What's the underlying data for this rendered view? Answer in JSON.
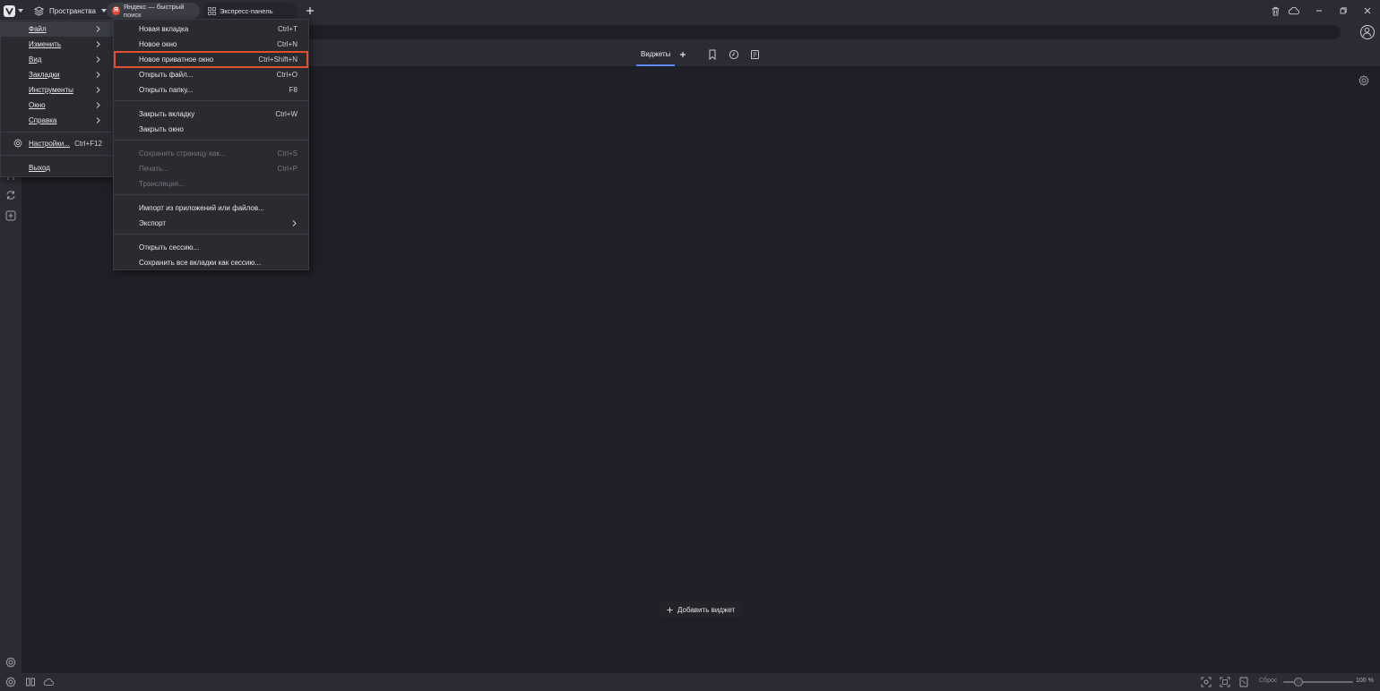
{
  "tabbar": {
    "spaces_label": "Пространства",
    "tabs": [
      {
        "title": "Яндекс — быстрый поиск",
        "favicon": "Я"
      },
      {
        "title": "Экспресс-панель"
      }
    ]
  },
  "speed_dial": {
    "active_tab": "Виджеты",
    "add_widget_label": "Добавить виджет"
  },
  "main_menu": {
    "items": [
      {
        "label": "Файл",
        "has_submenu": true
      },
      {
        "label": "Изменить",
        "has_submenu": true
      },
      {
        "label": "Вид",
        "has_submenu": true
      },
      {
        "label": "Закладки",
        "has_submenu": true
      },
      {
        "label": "Инструменты",
        "has_submenu": true
      },
      {
        "label": "Окно",
        "has_submenu": true
      },
      {
        "label": "Справка",
        "has_submenu": true
      },
      {
        "label": "Настройки...",
        "shortcut": "Ctrl+F12"
      },
      {
        "label": "Выход"
      }
    ]
  },
  "file_menu": {
    "items": [
      {
        "label": "Новая вкладка",
        "shortcut": "Ctrl+T"
      },
      {
        "label": "Новое окно",
        "shortcut": "Ctrl+N"
      },
      {
        "label": "Новое приватное окно",
        "shortcut": "Ctrl+Shift+N",
        "highlighted": true
      },
      {
        "label": "Открыть файл...",
        "shortcut": "Ctrl+O"
      },
      {
        "label": "Открыть папку...",
        "shortcut": "F8"
      },
      {
        "label": "Закрыть вкладку",
        "shortcut": "Ctrl+W"
      },
      {
        "label": "Закрыть окно",
        "shortcut": ""
      },
      {
        "label": "Сохранить страницу как...",
        "shortcut": "Ctrl+S",
        "disabled": true
      },
      {
        "label": "Печать...",
        "shortcut": "Ctrl+P",
        "disabled": true
      },
      {
        "label": "Трансляция...",
        "shortcut": "",
        "disabled": true
      },
      {
        "label": "Импорт из приложений или файлов...",
        "shortcut": ""
      },
      {
        "label": "Экспорт",
        "has_submenu": true
      },
      {
        "label": "Открыть сессию...",
        "shortcut": ""
      },
      {
        "label": "Сохранить все вкладки как сессию...",
        "shortcut": ""
      }
    ]
  },
  "statusbar": {
    "reset_label": "Сброс",
    "zoom_percent": 100,
    "zoom_label": "100 %"
  },
  "colors": {
    "background": "#1f2027",
    "chrome": "#2b2c33",
    "menu": "#2a2b31",
    "highlight_outline": "#e0502e",
    "accent": "#5b8bf0"
  }
}
